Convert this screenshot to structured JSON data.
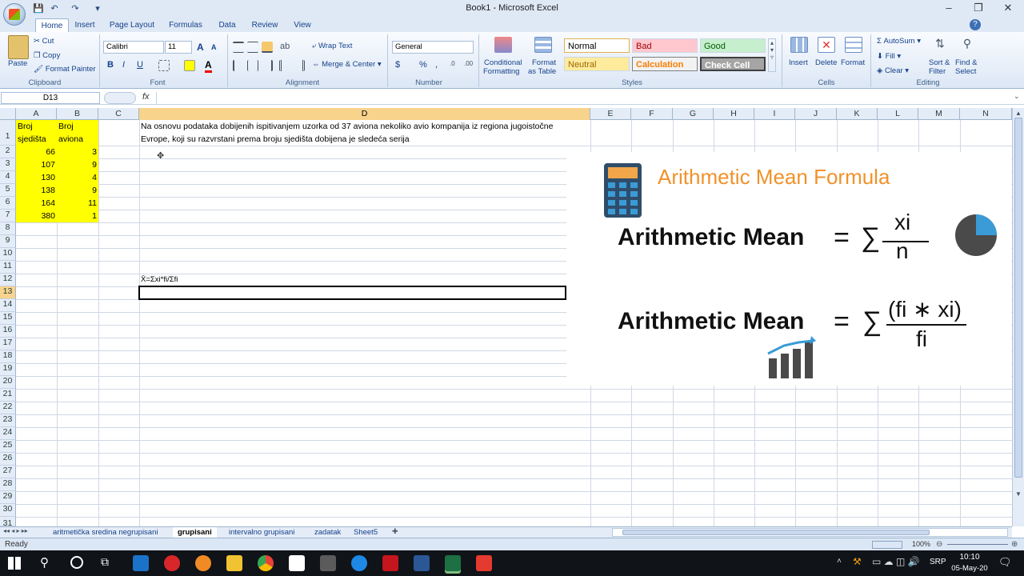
{
  "window": {
    "title": "Book1 - Microsoft Excel",
    "min": "–",
    "max": "❐",
    "close": "✕"
  },
  "tabs": [
    "Home",
    "Insert",
    "Page Layout",
    "Formulas",
    "Data",
    "Review",
    "View"
  ],
  "ribbon": {
    "clipboard": {
      "paste": "Paste",
      "cut": "Cut",
      "copy": "Copy",
      "format_painter": "Format Painter",
      "label": "Clipboard"
    },
    "font": {
      "name": "Calibri",
      "size": "11",
      "bold": "B",
      "italic": "I",
      "underline": "U",
      "grow": "A",
      "shrink": "A",
      "color": "A",
      "label": "Font"
    },
    "alignment": {
      "wrap": "Wrap Text",
      "merge": "Merge & Center",
      "label": "Alignment"
    },
    "number": {
      "format": "General",
      "currency": "$",
      "percent": "%",
      "comma": ",",
      "label": "Number"
    },
    "styles": {
      "conditional": "Conditional",
      "conditional2": "Formatting",
      "format_table": "Format",
      "format_table2": "as Table",
      "normal": "Normal",
      "bad": "Bad",
      "good": "Good",
      "neutral": "Neutral",
      "calculation": "Calculation",
      "check": "Check Cell",
      "label": "Styles"
    },
    "cells": {
      "insert": "Insert",
      "delete": "Delete",
      "format": "Format",
      "label": "Cells"
    },
    "editing": {
      "autosum": "AutoSum",
      "fill": "Fill",
      "clear": "Clear",
      "sort": "Sort &",
      "sort2": "Filter",
      "find": "Find &",
      "find2": "Select",
      "label": "Editing"
    }
  },
  "formula_bar": {
    "name_box": "D13",
    "fx": "fx",
    "content": ""
  },
  "columns": [
    "A",
    "B",
    "C",
    "D",
    "E",
    "F",
    "G",
    "H",
    "I",
    "J",
    "K",
    "L",
    "M",
    "N"
  ],
  "rows": [
    "1",
    "2",
    "3",
    "4",
    "5",
    "6",
    "7",
    "8",
    "9",
    "10",
    "11",
    "12",
    "13",
    "14",
    "15",
    "16",
    "17",
    "18",
    "19",
    "20",
    "21",
    "22",
    "23",
    "24",
    "25",
    "26",
    "27",
    "28",
    "29",
    "30",
    "31"
  ],
  "cells": {
    "a1_line1": "Broj",
    "a1_line2": "sjedišta",
    "b1_line1": "Broj",
    "b1_line2": "aviona",
    "a_values": [
      "66",
      "107",
      "130",
      "138",
      "164",
      "380"
    ],
    "b_values": [
      "3",
      "9",
      "4",
      "9",
      "11",
      "1"
    ],
    "d1_line1": "Na osnovu podataka dobijenih ispitivanjem uzorka od 37 aviona nekoliko avio kompanija iz regiona jugoistočne",
    "d1_line2": "Evrope, koji su razvrstani prema broju sjedišta dobijena je sledeća serija",
    "d12": "X̄=Σxi*fi/Σfi"
  },
  "overlay": {
    "title": "Arithmetic Mean Formula",
    "label1": "Arithmetic Mean",
    "label2": "Arithmetic Mean",
    "eq": "=",
    "sigma": "∑",
    "f1_num": "xi",
    "f1_den": "n",
    "f2_num": "(fi ∗ xi)",
    "f2_den": "fi"
  },
  "sheets": [
    "aritmetička sredina negrupisani",
    "grupisani",
    "intervalno grupisani",
    "zadatak",
    "Sheet5"
  ],
  "status": {
    "ready": "Ready",
    "zoom": "100%"
  },
  "taskbar": {
    "time": "10:10",
    "date": "05-May-20",
    "lang": "SRP"
  },
  "colors": {
    "accent_orange": "#f0922b",
    "yellow": "#ffff00",
    "selected_header": "#f8d38c"
  }
}
